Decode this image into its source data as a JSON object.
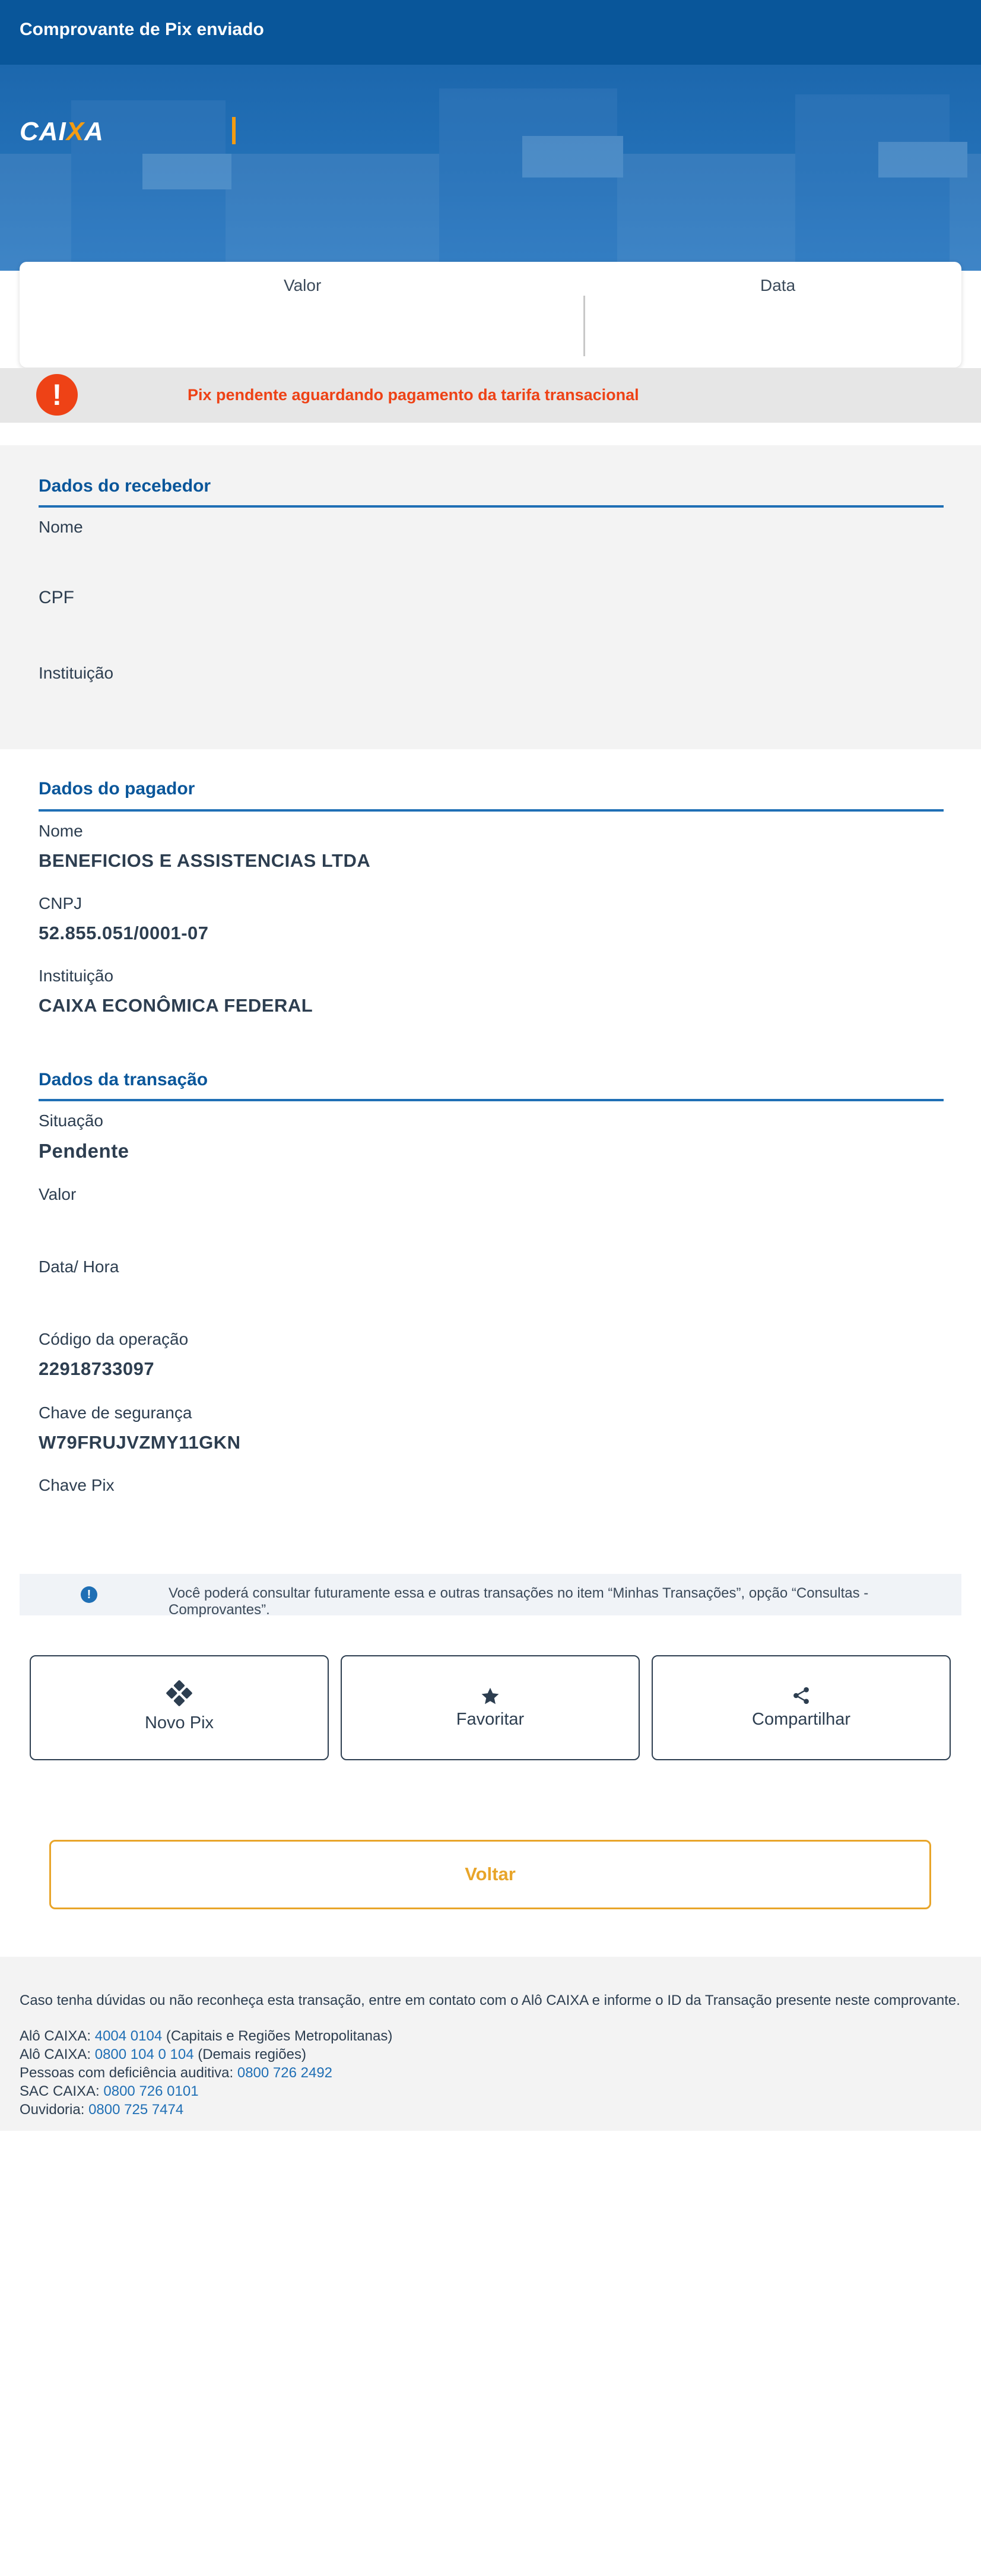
{
  "header": {
    "title": "Comprovante de Pix enviado"
  },
  "hero": {
    "logo_prefix": "CAIXA"
  },
  "summary": {
    "valor_label": "Valor",
    "data_label": "Data"
  },
  "alert": {
    "text": "Pix pendente aguardando pagamento da tarifa transacional"
  },
  "recebedor": {
    "title": "Dados do recebedor",
    "nome_label": "Nome",
    "cpf_label": "CPF",
    "instituicao_label": "Instituição"
  },
  "pagador": {
    "title": "Dados do pagador",
    "nome_label": "Nome",
    "nome_value": "BENEFICIOS E ASSISTENCIAS LTDA",
    "cnpj_label": "CNPJ",
    "cnpj_value": "52.855.051/0001-07",
    "instituicao_label": "Instituição",
    "instituicao_value": "CAIXA ECONÔMICA FEDERAL"
  },
  "transacao": {
    "title": "Dados da transação",
    "situacao_label": "Situação",
    "situacao_value": "Pendente",
    "valor_label": "Valor",
    "datahora_label": "Data/ Hora",
    "codigo_label": "Código da operação",
    "codigo_value": "22918733097",
    "chave_seg_label": "Chave de segurança",
    "chave_seg_value": "W79FRUJVZMY11GKN",
    "chave_pix_label": "Chave Pix"
  },
  "info": {
    "text": "Você poderá consultar futuramente essa e outras transações no item “Minhas Transações”, opção “Consultas - Comprovantes”."
  },
  "actions": {
    "novo_pix": "Novo Pix",
    "favoritar": "Favoritar",
    "compartilhar": "Compartilhar"
  },
  "voltar": "Voltar",
  "footer": {
    "intro": "Caso tenha dúvidas ou não reconheça esta transação, entre em contato com o Alô CAIXA e informe o ID da Transação presente neste comprovante.",
    "line1_label": "Alô CAIXA:",
    "line1_phone": "4004 0104",
    "line1_note": "(Capitais e Regiões Metropolitanas)",
    "line2_label": "Alô CAIXA:",
    "line2_phone": "0800 104 0 104",
    "line2_note": "(Demais regiões)",
    "line3_label": "Pessoas com deficiência auditiva:",
    "line3_phone": "0800 726 2492",
    "line4_label": "SAC CAIXA:",
    "line4_phone": "0800 726 0101",
    "line5_label": "Ouvidoria:",
    "line5_phone": "0800 725 7474"
  },
  "colors": {
    "brand_blue": "#09569a",
    "accent_orange": "#e8a52a",
    "alert_red": "#ee4216"
  }
}
